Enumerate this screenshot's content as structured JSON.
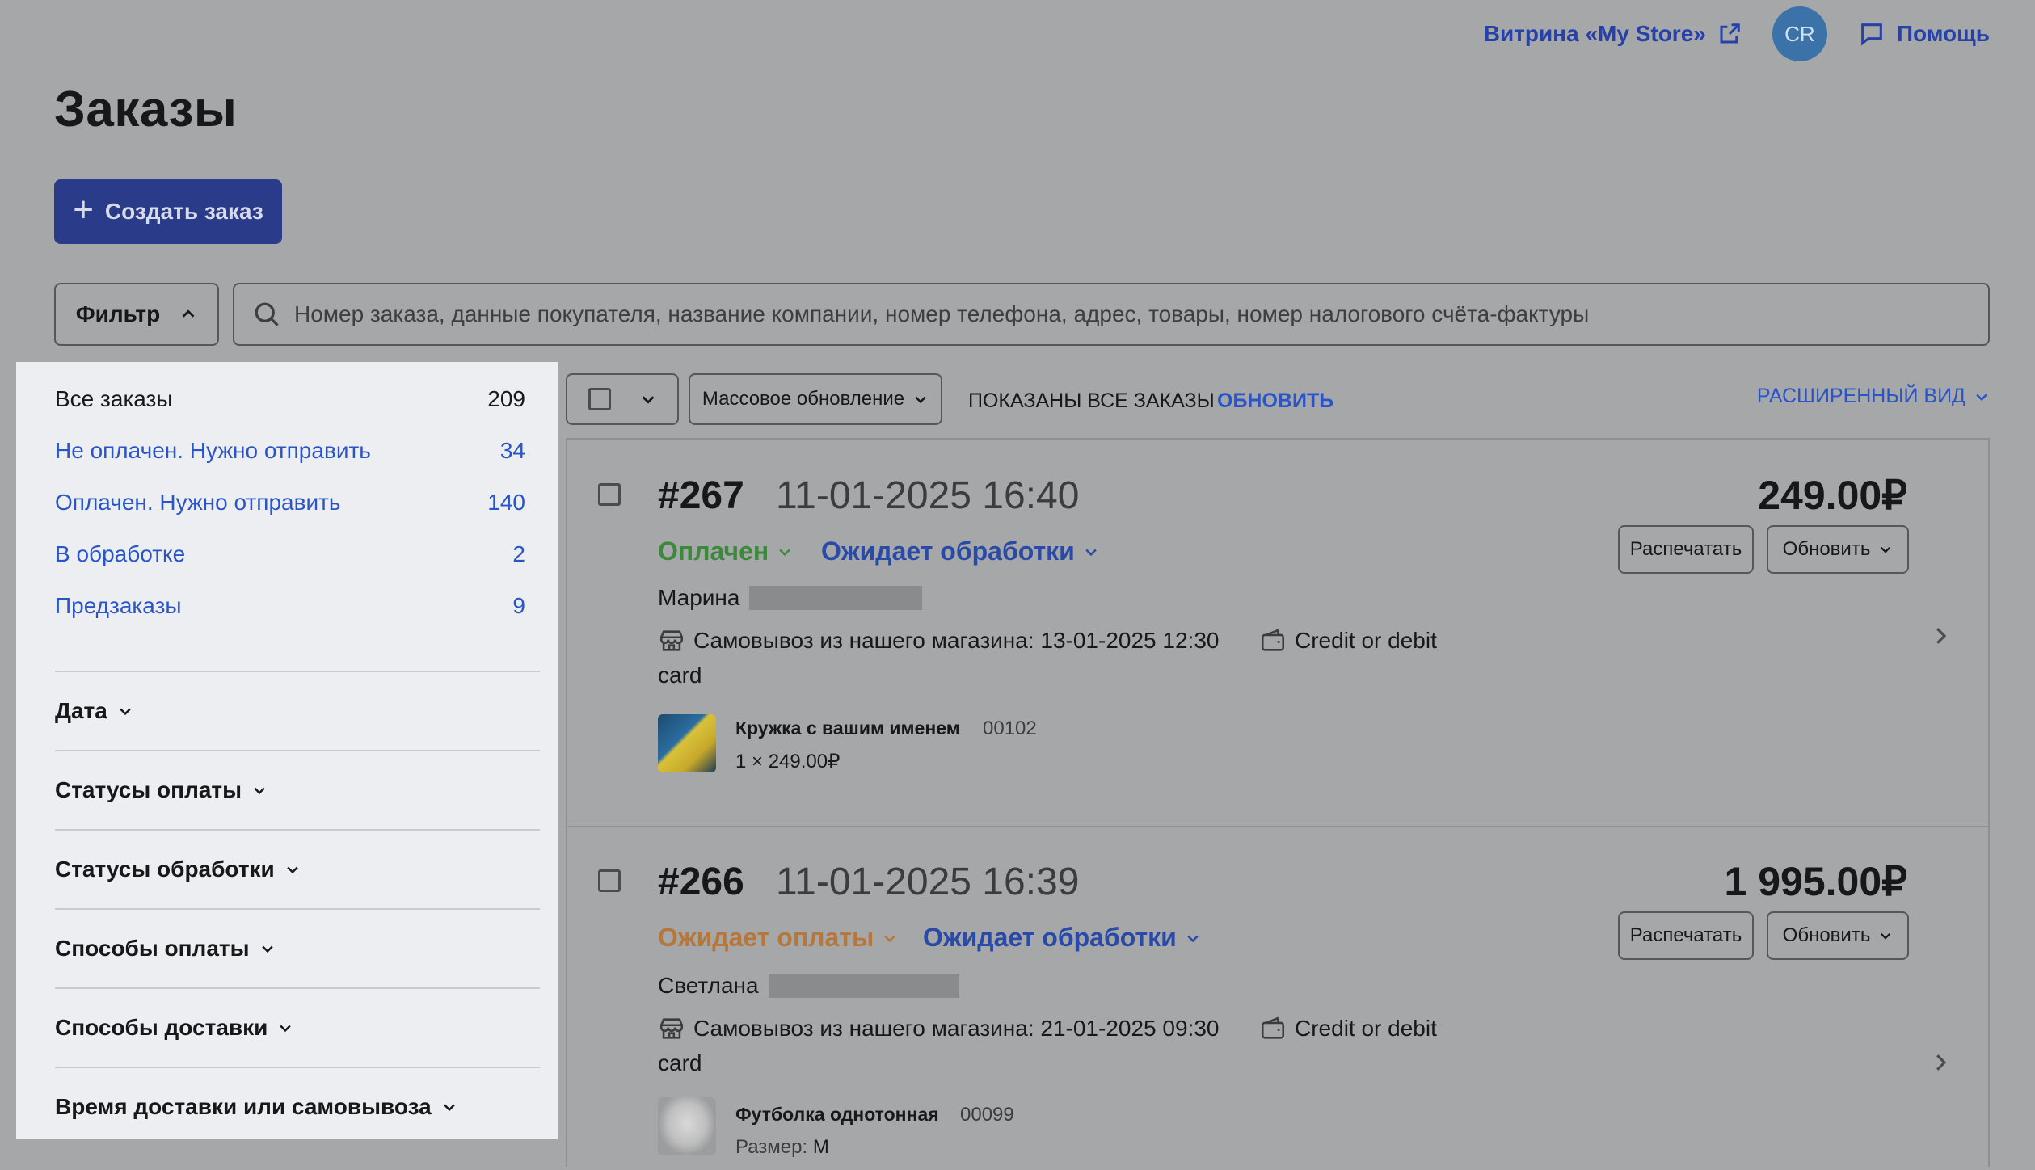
{
  "topbar": {
    "store_link": "Витрина «My Store»",
    "avatar_initials": "CR",
    "help": "Помощь"
  },
  "page": {
    "title": "Заказы",
    "create_button": "Создать заказ",
    "filter_button": "Фильтр",
    "search_placeholder": "Номер заказа, данные покупателя, название компании, номер телефона, адрес, товары, номер налогового счёта-фактуры"
  },
  "sidebar": {
    "statuses": [
      {
        "label": "Все заказы",
        "count": "209"
      },
      {
        "label": "Не оплачен. Нужно отправить",
        "count": "34"
      },
      {
        "label": "Оплачен. Нужно отправить",
        "count": "140"
      },
      {
        "label": "В обработке",
        "count": "2"
      },
      {
        "label": "Предзаказы",
        "count": "9"
      }
    ],
    "sections": [
      "Дата",
      "Статусы оплаты",
      "Статусы обработки",
      "Способы оплаты",
      "Способы доставки",
      "Время доставки или самовывоза"
    ]
  },
  "toolbar": {
    "mass_update": "Массовое обновление",
    "shown_all": "ПОКАЗАНЫ ВСЕ ЗАКАЗЫ",
    "refresh": "ОБНОВИТЬ",
    "advanced_view": "РАСШИРЕННЫЙ ВИД"
  },
  "orders": [
    {
      "number": "#267",
      "datetime": "11-01-2025 16:40",
      "payment_status": "Оплачен",
      "payment_status_color": "#3a8a3a",
      "processing_status": "Ожидает обработки",
      "price": "249.00₽",
      "print_button": "Распечатать",
      "update_button": "Обновить",
      "customer": "Марина",
      "delivery": "Самовывоз из нашего магазина: 13-01-2025 12:30",
      "payment_method_line1": "Credit or debit",
      "payment_method_line2": "card",
      "item_name": "Кружка с вашим именем",
      "item_sku": "00102",
      "item_detail": "1 × 249.00₽",
      "thumb_icon": "yellow-mug-image"
    },
    {
      "number": "#266",
      "datetime": "11-01-2025 16:39",
      "payment_status": "Ожидает оплаты",
      "payment_status_color": "#b8773a",
      "processing_status": "Ожидает обработки",
      "price": "1 995.00₽",
      "print_button": "Распечатать",
      "update_button": "Обновить",
      "customer": "Светлана",
      "delivery": "Самовывоз из нашего магазина: 21-01-2025 09:30",
      "payment_method_line1": "Credit or debit",
      "payment_method_line2": "card",
      "item_name": "Футболка однотонная",
      "item_sku": "00099",
      "item_detail_label": "Размер:",
      "item_detail_value": "M",
      "thumb_icon": "white-tshirt-image"
    }
  ],
  "colors": {
    "accent_blue": "#2a55c9",
    "button_primary": "#2a3b8a",
    "overlay_bg": "#a6a7a9",
    "sidebar_bg": "#eceef1"
  }
}
